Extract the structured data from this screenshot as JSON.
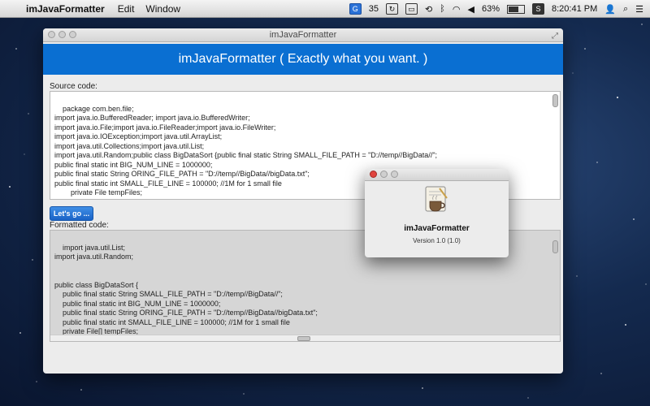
{
  "menubar": {
    "app_name": "imJavaFormatter",
    "menus": [
      "Edit",
      "Window"
    ],
    "status_number": "35",
    "battery": "63%",
    "clock": "8:20:41 PM"
  },
  "window": {
    "title": "imJavaFormatter",
    "banner": "imJavaFormatter ( Exactly what you want. )",
    "source_label": "Source code:",
    "source_code": "package com.ben.file;\nimport java.io.BufferedReader; import java.io.BufferedWriter;\nimport java.io.File;import java.io.FileReader;import java.io.FileWriter;\nimport java.io.IOException;import java.util.ArrayList;\nimport java.util.Collections;import java.util.List;\nimport java.util.Random;public class BigDataSort {public final static String SMALL_FILE_PATH = \"D://temp//BigData//\";\npublic final static int BIG_NUM_LINE = 1000000;\npublic final static String ORING_FILE_PATH = \"D://temp//BigData//bigData.txt\";\npublic final static int SMALL_FILE_LINE = 100000; //1M for 1 small file\n        private File tempFiles;\n\n        public BigDataSort() throws IOException {",
    "go_button": "Let's go ...",
    "formatted_label": "Formatted code:",
    "formatted_code": "import java.util.List;\nimport java.util.Random;\n\n\npublic class BigDataSort {\n    public final static String SMALL_FILE_PATH = \"D://temp//BigData//\";\n    public final static int BIG_NUM_LINE = 1000000;\n    public final static String ORING_FILE_PATH = \"D://temp//BigData//bigData.txt\";\n    public final static int SMALL_FILE_LINE = 100000; //1M for 1 small file\n    private File[] tempFiles;\n\n    public BigDataSort() throws IOException {"
  },
  "about": {
    "title": "imJavaFormatter",
    "version": "Version 1.0 (1.0)"
  },
  "colors": {
    "banner": "#0a6fd2",
    "button": "#1a63c6"
  }
}
